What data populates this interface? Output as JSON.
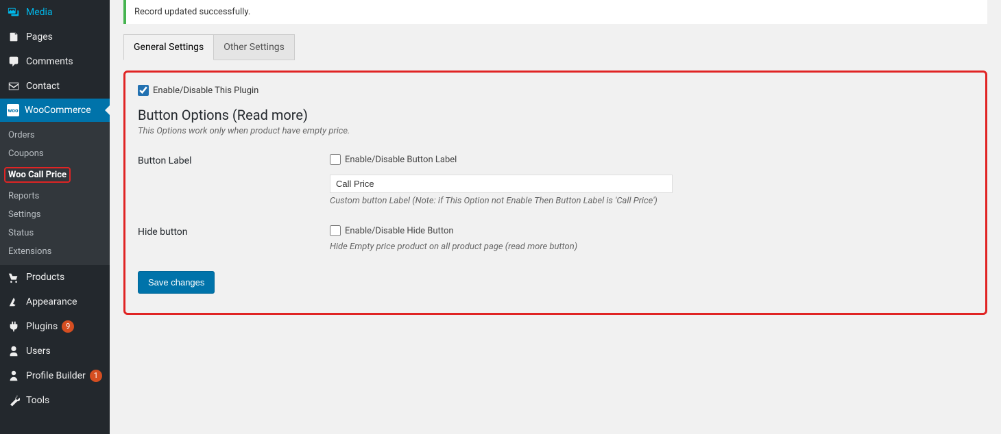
{
  "sidebar": {
    "top": [
      {
        "label": "Media",
        "icon": "media-icon"
      },
      {
        "label": "Pages",
        "icon": "pages-icon"
      },
      {
        "label": "Comments",
        "icon": "comments-icon"
      },
      {
        "label": "Contact",
        "icon": "contact-icon"
      }
    ],
    "woocommerce_label": "WooCommerce",
    "sub": [
      {
        "label": "Orders"
      },
      {
        "label": "Coupons"
      },
      {
        "label": "Woo Call Price",
        "current": true
      },
      {
        "label": "Reports"
      },
      {
        "label": "Settings"
      },
      {
        "label": "Status"
      },
      {
        "label": "Extensions"
      }
    ],
    "bottom": [
      {
        "label": "Products",
        "icon": "products-icon",
        "badge": ""
      },
      {
        "label": "Appearance",
        "icon": "appearance-icon",
        "badge": ""
      },
      {
        "label": "Plugins",
        "icon": "plugins-icon",
        "badge": "9"
      },
      {
        "label": "Users",
        "icon": "users-icon",
        "badge": ""
      },
      {
        "label": "Profile Builder",
        "icon": "profile-icon",
        "badge": "1"
      },
      {
        "label": "Tools",
        "icon": "tools-icon",
        "badge": ""
      }
    ]
  },
  "notice": "Record updated successfully.",
  "tabs": [
    {
      "label": "General Settings",
      "active": true
    },
    {
      "label": "Other Settings",
      "active": false
    }
  ],
  "panel": {
    "enable_label": "Enable/Disable This Plugin",
    "enable_checked": true,
    "section_title": "Button Options (Read more)",
    "section_desc": "This Options work only when product have empty price.",
    "rows": {
      "button_label": {
        "label": "Button Label",
        "cb_label": "Enable/Disable Button Label",
        "cb_checked": false,
        "input_value": "Call Price",
        "hint": "Custom button Label (Note: if This Option not Enable Then Button Label is 'Call Price')"
      },
      "hide_button": {
        "label": "Hide button",
        "cb_label": "Enable/Disable Hide Button",
        "cb_checked": false,
        "hint": "Hide Empty price product on all product page (read more button)"
      }
    },
    "save_label": "Save changes"
  }
}
